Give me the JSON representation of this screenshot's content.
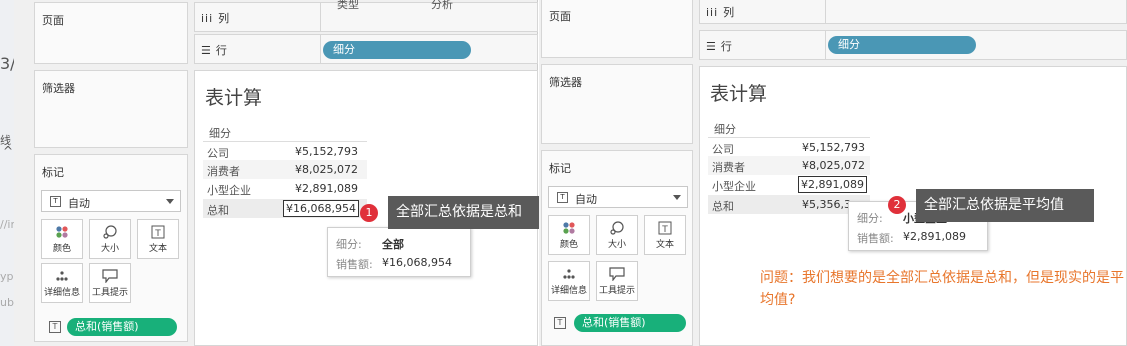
{
  "left_panel": {
    "pages_title": "页面",
    "filters_title": "筛选器",
    "marks_title": "标记",
    "mark_type": "自动",
    "mark_buttons": [
      "颜色",
      "大小",
      "文本",
      "详细信息",
      "工具提示"
    ],
    "text_icon_glyph": "T",
    "measure_pill": "总和(销售额)",
    "columns_label": "列",
    "rows_label": "行",
    "rows_pill": "细分",
    "header_fragments": [
      "类型",
      "分析"
    ]
  },
  "left_view": {
    "title": "表计算",
    "header": "细分",
    "rows": [
      {
        "label": "公司",
        "value": "¥5,152,793"
      },
      {
        "label": "消费者",
        "value": "¥8,025,072"
      },
      {
        "label": "小型企业",
        "value": "¥2,891,089"
      },
      {
        "label": "总和",
        "value": "¥16,068,954"
      }
    ],
    "tooltip": {
      "k1": "细分:",
      "v1": "全部",
      "k2": "销售额:",
      "v2": "¥16,068,954"
    },
    "badge": "1",
    "callout": "全部汇总依据是总和"
  },
  "right_panel": {
    "pages_title": "页面",
    "filters_title": "筛选器",
    "marks_title": "标记",
    "mark_type": "自动",
    "mark_buttons": [
      "颜色",
      "大小",
      "文本",
      "详细信息",
      "工具提示"
    ],
    "text_icon_glyph": "T",
    "measure_pill": "总和(销售额)",
    "columns_label": "列",
    "rows_label": "行",
    "rows_pill": "细分"
  },
  "right_view": {
    "title": "表计算",
    "header": "细分",
    "rows": [
      {
        "label": "公司",
        "value": "¥5,152,793"
      },
      {
        "label": "消费者",
        "value": "¥8,025,072"
      },
      {
        "label": "小型企业",
        "value": "¥2,891,089"
      },
      {
        "label": "总和",
        "value": "¥5,356,3"
      }
    ],
    "tooltip": {
      "k1": "细分:",
      "v1": "小型企业",
      "k2": "销售额:",
      "v2": "¥2,891,089"
    },
    "badge": "2",
    "callout": "全部汇总依据是平均值",
    "question": "问题：我们想要的是全部汇总依据是总和，但是现实的是平均值?"
  },
  "background_fragments": [
    "3/",
    "线",
    "^",
    "//ir",
    "ype",
    "ub"
  ],
  "colors": {
    "pill_blue": "#4a97b5",
    "pill_green": "#18b07a",
    "callout_bg": "#5a5a5a",
    "badge_red": "#e0303a",
    "question_orange": "#e8762c"
  }
}
